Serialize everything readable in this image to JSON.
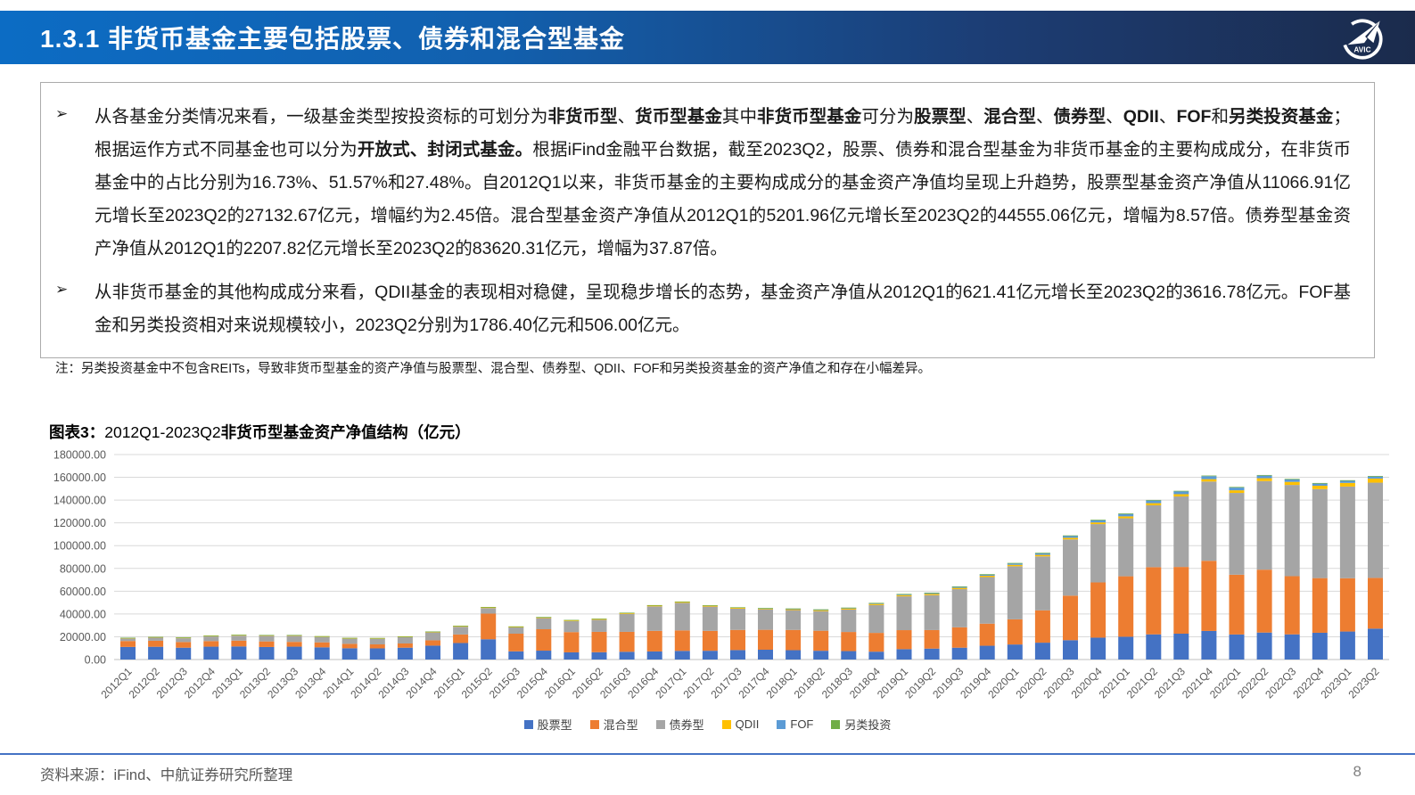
{
  "header": {
    "title": "1.3.1 非货币基金主要包括股票、债券和混合型基金",
    "logo_label": "AVIC"
  },
  "content_box": {
    "bullets": [
      {
        "marker": "➢",
        "segments": [
          {
            "t": "从各基金分类情况来看，一级基金类型按投资标的可划分为"
          },
          {
            "t": "非货币型",
            "b": true
          },
          {
            "t": "、"
          },
          {
            "t": "货币型基金",
            "b": true
          },
          {
            "t": "其中"
          },
          {
            "t": "非货币型基金",
            "b": true
          },
          {
            "t": "可分为"
          },
          {
            "t": "股票型",
            "b": true
          },
          {
            "t": "、"
          },
          {
            "t": "混合型",
            "b": true
          },
          {
            "t": "、"
          },
          {
            "t": "债券型",
            "b": true
          },
          {
            "t": "、"
          },
          {
            "t": "QDII",
            "b": true
          },
          {
            "t": "、"
          },
          {
            "t": "FOF",
            "b": true
          },
          {
            "t": "和"
          },
          {
            "t": "另类投资基金",
            "b": true
          },
          {
            "t": "；根据运作方式不同基金也可以分为"
          },
          {
            "t": "开放式、封闭式基金。",
            "b": true
          },
          {
            "t": "根据iFind金融平台数据，截至2023Q2，股票、债券和混合型基金为非货币基金的主要构成成分，在非货币基金中的占比分别为16.73%、51.57%和27.48%。自2012Q1以来，非货币基金的主要构成成分的基金资产净值均呈现上升趋势，股票型基金资产净值从11066.91亿元增长至2023Q2的27132.67亿元，增幅约为2.45倍。混合型基金资产净值从2012Q1的5201.96亿元增长至2023Q2的44555.06亿元，增幅为8.57倍。债券型基金资产净值从2012Q1的2207.82亿元增长至2023Q2的83620.31亿元，增幅为37.87倍。"
          }
        ]
      },
      {
        "marker": "➢",
        "segments": [
          {
            "t": "从非货币基金的其他构成成分来看，QDII基金的表现相对稳健，呈现稳步增长的态势，基金资产净值从2012Q1的621.41亿元增长至2023Q2的3616.78亿元。FOF基金和另类投资相对来说规模较小，2023Q2分别为1786.40亿元和506.00亿元。"
          }
        ]
      }
    ],
    "note": "注：另类投资基金中不包含REITs，导致非货币型基金的资产净值与股票型、混合型、债券型、QDII、FOF和另类投资基金的资产净值之和存在小幅差异。"
  },
  "figure": {
    "title_segments": [
      {
        "t": "图表3：",
        "b": true
      },
      {
        "t": "2012Q1-2023Q2"
      },
      {
        "t": "非货币型基金资产净值结构（亿元）",
        "b": true
      }
    ]
  },
  "chart_data": {
    "type": "bar",
    "stacked": true,
    "title": "图表3：2012Q1-2023Q2非货币型基金资产净值结构（亿元）",
    "ylabel": "",
    "xlabel": "",
    "ylim": [
      0,
      180000
    ],
    "ytick_step": 20000,
    "grid": true,
    "legend_position": "bottom",
    "categories": [
      "2012Q1",
      "2012Q2",
      "2012Q3",
      "2012Q4",
      "2013Q1",
      "2013Q2",
      "2013Q3",
      "2013Q4",
      "2014Q1",
      "2014Q2",
      "2014Q3",
      "2014Q4",
      "2015Q1",
      "2015Q2",
      "2015Q3",
      "2015Q4",
      "2016Q1",
      "2016Q2",
      "2016Q3",
      "2016Q4",
      "2017Q1",
      "2017Q2",
      "2017Q3",
      "2017Q4",
      "2018Q1",
      "2018Q2",
      "2018Q3",
      "2018Q4",
      "2019Q1",
      "2019Q2",
      "2019Q3",
      "2019Q4",
      "2020Q1",
      "2020Q2",
      "2020Q3",
      "2020Q4",
      "2021Q1",
      "2021Q2",
      "2021Q3",
      "2021Q4",
      "2022Q1",
      "2022Q2",
      "2022Q3",
      "2022Q4",
      "2023Q1",
      "2023Q2"
    ],
    "series": [
      {
        "name": "股票型",
        "color": "#4472C4",
        "values": [
          11066.91,
          11200,
          10400,
          11300,
          11500,
          11000,
          11300,
          10700,
          9900,
          9800,
          10400,
          12200,
          14500,
          17800,
          7200,
          7800,
          6300,
          6400,
          6800,
          7100,
          7600,
          7700,
          8300,
          8600,
          8200,
          7700,
          7400,
          6900,
          9100,
          9600,
          10400,
          12100,
          13200,
          14800,
          17000,
          19200,
          20000,
          22100,
          22700,
          25100,
          22000,
          23700,
          22100,
          23500,
          24600,
          27132.67
        ]
      },
      {
        "name": "混合型",
        "color": "#ED7D31",
        "values": [
          5201.96,
          5300,
          5000,
          4900,
          5100,
          4900,
          4200,
          4400,
          3900,
          3500,
          3700,
          4700,
          7500,
          22500,
          15500,
          18800,
          17800,
          17900,
          17500,
          18100,
          18000,
          17500,
          17700,
          17500,
          17800,
          17600,
          16800,
          16500,
          16700,
          16300,
          17900,
          19400,
          22100,
          28400,
          39100,
          48500,
          53100,
          59000,
          58600,
          61600,
          52500,
          55200,
          51100,
          48000,
          46800,
          44555.06
        ]
      },
      {
        "name": "债券型",
        "color": "#A5A5A5",
        "values": [
          2207.82,
          2700,
          3300,
          4100,
          4400,
          4900,
          5300,
          4700,
          4500,
          4900,
          5500,
          6900,
          6800,
          4900,
          5500,
          9800,
          9700,
          10600,
          15800,
          21500,
          24200,
          21300,
          18700,
          17800,
          17400,
          17200,
          19700,
          24400,
          29700,
          30600,
          33500,
          40900,
          46600,
          47400,
          49400,
          51200,
          50900,
          54300,
          61900,
          69600,
          71800,
          77800,
          80100,
          78200,
          80500,
          83620.31
        ]
      },
      {
        "name": "QDII",
        "color": "#FFC000",
        "values": [
          621.41,
          620,
          630,
          640,
          650,
          660,
          650,
          640,
          630,
          640,
          660,
          680,
          750,
          800,
          760,
          780,
          800,
          820,
          850,
          880,
          900,
          900,
          920,
          940,
          960,
          980,
          1000,
          1000,
          1050,
          1080,
          1100,
          1150,
          1250,
          1300,
          1400,
          1500,
          1700,
          1900,
          2000,
          2100,
          2300,
          2500,
          2700,
          2900,
          3200,
          3616.78
        ]
      },
      {
        "name": "FOF",
        "color": "#5B9BD5",
        "values": [
          0,
          0,
          0,
          0,
          0,
          0,
          0,
          0,
          0,
          0,
          0,
          0,
          0,
          0,
          0,
          0,
          0,
          0,
          0,
          0,
          0,
          0,
          0,
          130,
          200,
          300,
          400,
          600,
          700,
          800,
          900,
          1000,
          1200,
          1400,
          1600,
          1900,
          2100,
          2300,
          2400,
          2600,
          2400,
          2300,
          2100,
          1900,
          1850,
          1786.4
        ]
      },
      {
        "name": "另类投资",
        "color": "#70AD47",
        "values": [
          80,
          80,
          90,
          90,
          100,
          100,
          110,
          110,
          120,
          120,
          130,
          140,
          150,
          160,
          160,
          170,
          180,
          190,
          200,
          220,
          240,
          250,
          260,
          280,
          300,
          310,
          320,
          340,
          360,
          380,
          400,
          420,
          450,
          470,
          480,
          500,
          520,
          530,
          540,
          550,
          540,
          530,
          520,
          510,
          505,
          506.0
        ]
      }
    ]
  },
  "footer": {
    "source": "资料来源：iFind、中航证券研究所整理",
    "page": "8"
  }
}
